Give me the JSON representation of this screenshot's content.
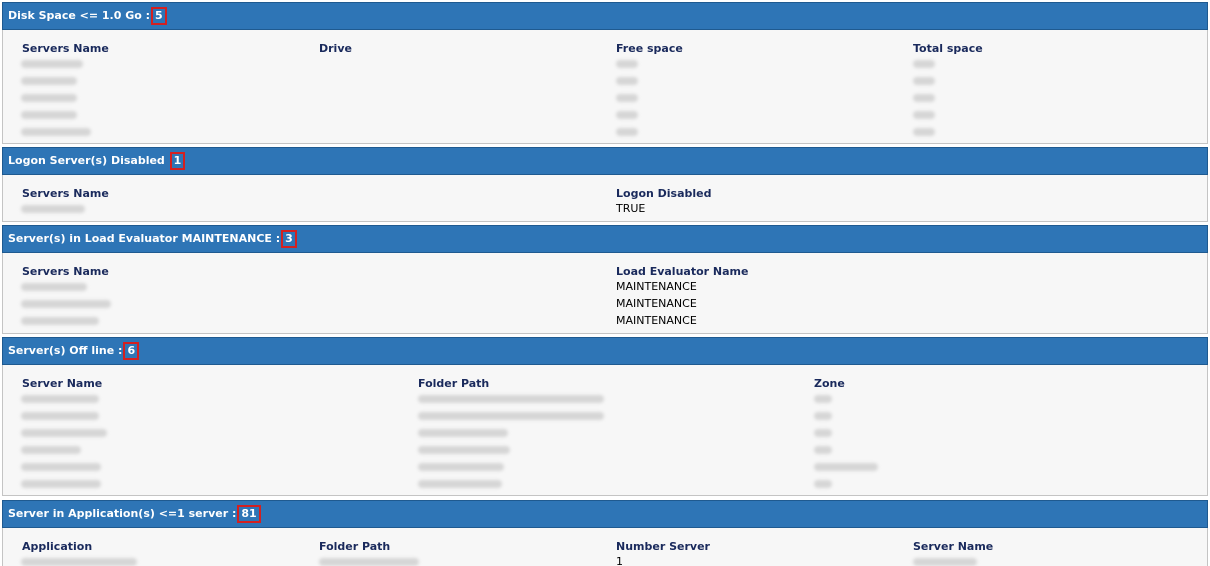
{
  "sections": {
    "disk": {
      "title": "Disk Space <= 1.0 Go :",
      "count": "5",
      "columns": [
        "Servers Name",
        "Drive",
        "Free space",
        "Total space"
      ]
    },
    "logon": {
      "title": "Logon Server(s) Disabled",
      "count": "1",
      "columns": [
        "Servers Name",
        "Logon Disabled"
      ],
      "rows": [
        [
          "TRUE"
        ]
      ]
    },
    "load": {
      "title": "Server(s) in Load Evaluator MAINTENANCE :",
      "count": "3",
      "columns": [
        "Servers Name",
        "Load Evaluator Name"
      ],
      "rows": [
        [
          "MAINTENANCE"
        ],
        [
          "MAINTENANCE"
        ],
        [
          "MAINTENANCE"
        ]
      ]
    },
    "offline": {
      "title": "Server(s) Off line :",
      "count": "6",
      "columns": [
        "Server Name",
        "Folder Path",
        "Zone"
      ]
    },
    "apps": {
      "title": "Server in Application(s) <=1 server :",
      "count": "81",
      "columns": [
        "Application",
        "Folder Path",
        "Number Server",
        "Server Name"
      ],
      "rows": [
        [
          "1"
        ]
      ]
    }
  }
}
